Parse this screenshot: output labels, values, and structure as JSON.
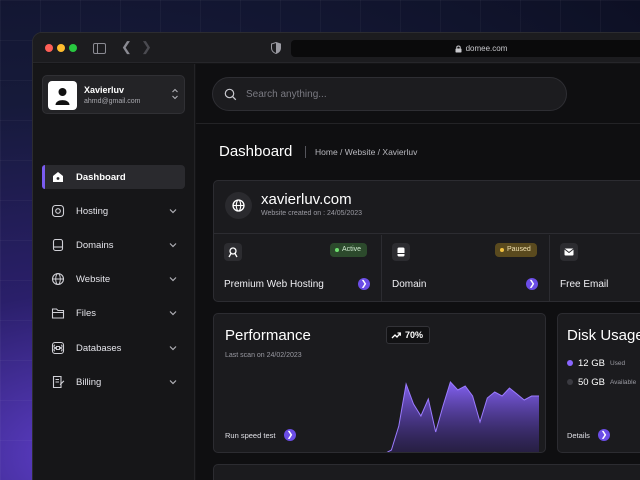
{
  "browser": {
    "url": "domee.com"
  },
  "user": {
    "name": "Xavierluv",
    "email": "ahmd@gmail.com"
  },
  "sidebar": {
    "items": [
      {
        "label": "Dashboard",
        "icon": "home-icon",
        "active": true
      },
      {
        "label": "Hosting",
        "icon": "hosting-icon"
      },
      {
        "label": "Domains",
        "icon": "domain-icon"
      },
      {
        "label": "Website",
        "icon": "globe-icon"
      },
      {
        "label": "Files",
        "icon": "folder-icon"
      },
      {
        "label": "Databases",
        "icon": "command-icon"
      },
      {
        "label": "Billing",
        "icon": "billing-icon"
      }
    ]
  },
  "search": {
    "placeholder": "Search anything..."
  },
  "header": {
    "title": "Dashboard",
    "breadcrumb": "Home / Website / Xavierluv"
  },
  "site": {
    "name": "xavierluv.com",
    "created": "Website created on : 24/05/2023",
    "services": [
      {
        "label": "Premium Web Hosting",
        "status": "Active",
        "icon": "hosting-icon"
      },
      {
        "label": "Domain",
        "status": "Paused",
        "icon": "domain-icon"
      },
      {
        "label": "Free Email",
        "status": "",
        "icon": "mail-icon"
      }
    ]
  },
  "performance": {
    "title": "Performance",
    "scan": "Last scan on 24/02/2023",
    "percent": "70%",
    "link": "Run speed test"
  },
  "disk": {
    "title": "Disk Usage",
    "used_value": "12 GB",
    "used_label": "Used",
    "avail_value": "50 GB",
    "avail_label": "Available",
    "link": "Details"
  },
  "colors": {
    "accent": "#6b4de6",
    "active": "#2c4a2c",
    "paused": "#5a4a1e"
  },
  "chart_data": {
    "type": "area",
    "series": [
      {
        "values": [
          0,
          4,
          28,
          70,
          50,
          38,
          55,
          22,
          48,
          72,
          64,
          68,
          58,
          32,
          56,
          62,
          58,
          66,
          60,
          54,
          58,
          58
        ]
      }
    ],
    "ylim": [
      0,
      100
    ],
    "grid": false
  }
}
